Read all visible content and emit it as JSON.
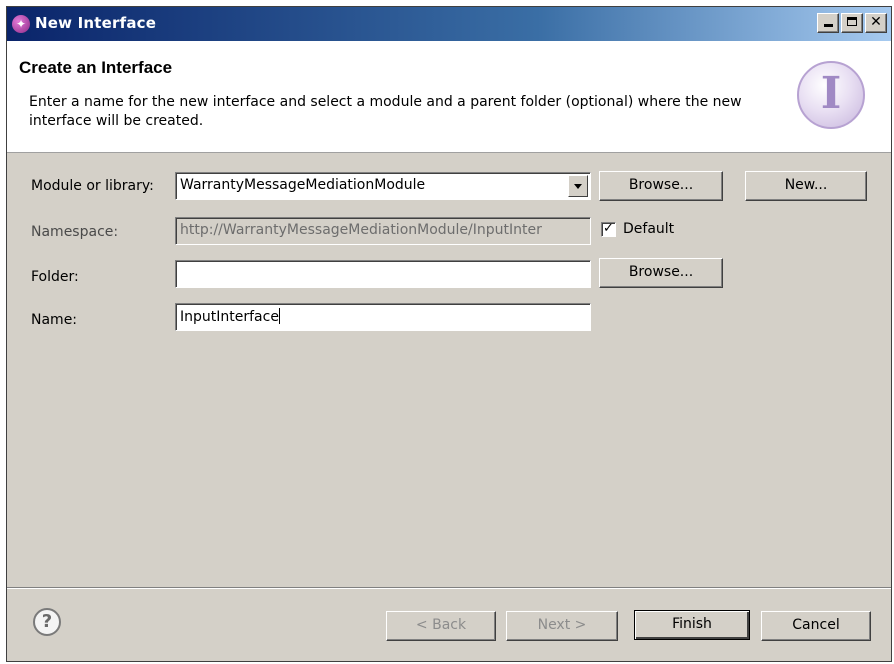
{
  "window": {
    "title": "New Interface",
    "app_icon": "interface-wizard-icon",
    "controls": [
      "minimize",
      "maximize",
      "close"
    ]
  },
  "header": {
    "title": "Create an Interface",
    "description": "Enter a name for the new interface and select a module and a parent folder (optional) where the new interface will be created.",
    "icon": "interface-banner-icon",
    "icon_glyph": "I"
  },
  "form": {
    "module": {
      "label": "Module or library:",
      "value": "WarrantyMessageMediationModule",
      "browse_label": "Browse...",
      "new_label": "New..."
    },
    "namespace": {
      "label": "Namespace:",
      "value": "http://WarrantyMessageMediationModule/InputInter",
      "default_label": "Default",
      "default_checked": true
    },
    "folder": {
      "label": "Folder:",
      "value": "",
      "browse_label": "Browse..."
    },
    "name": {
      "label": "Name:",
      "value": "InputInterface"
    }
  },
  "footer": {
    "help_glyph": "?",
    "back_label": "< Back",
    "next_label": "Next >",
    "finish_label": "Finish",
    "cancel_label": "Cancel"
  },
  "colors": {
    "titlebar": "#0a246a",
    "dialog_bg": "#d4d0c8",
    "header_bg": "#ffffff",
    "icon_accent": "#a089c4"
  }
}
